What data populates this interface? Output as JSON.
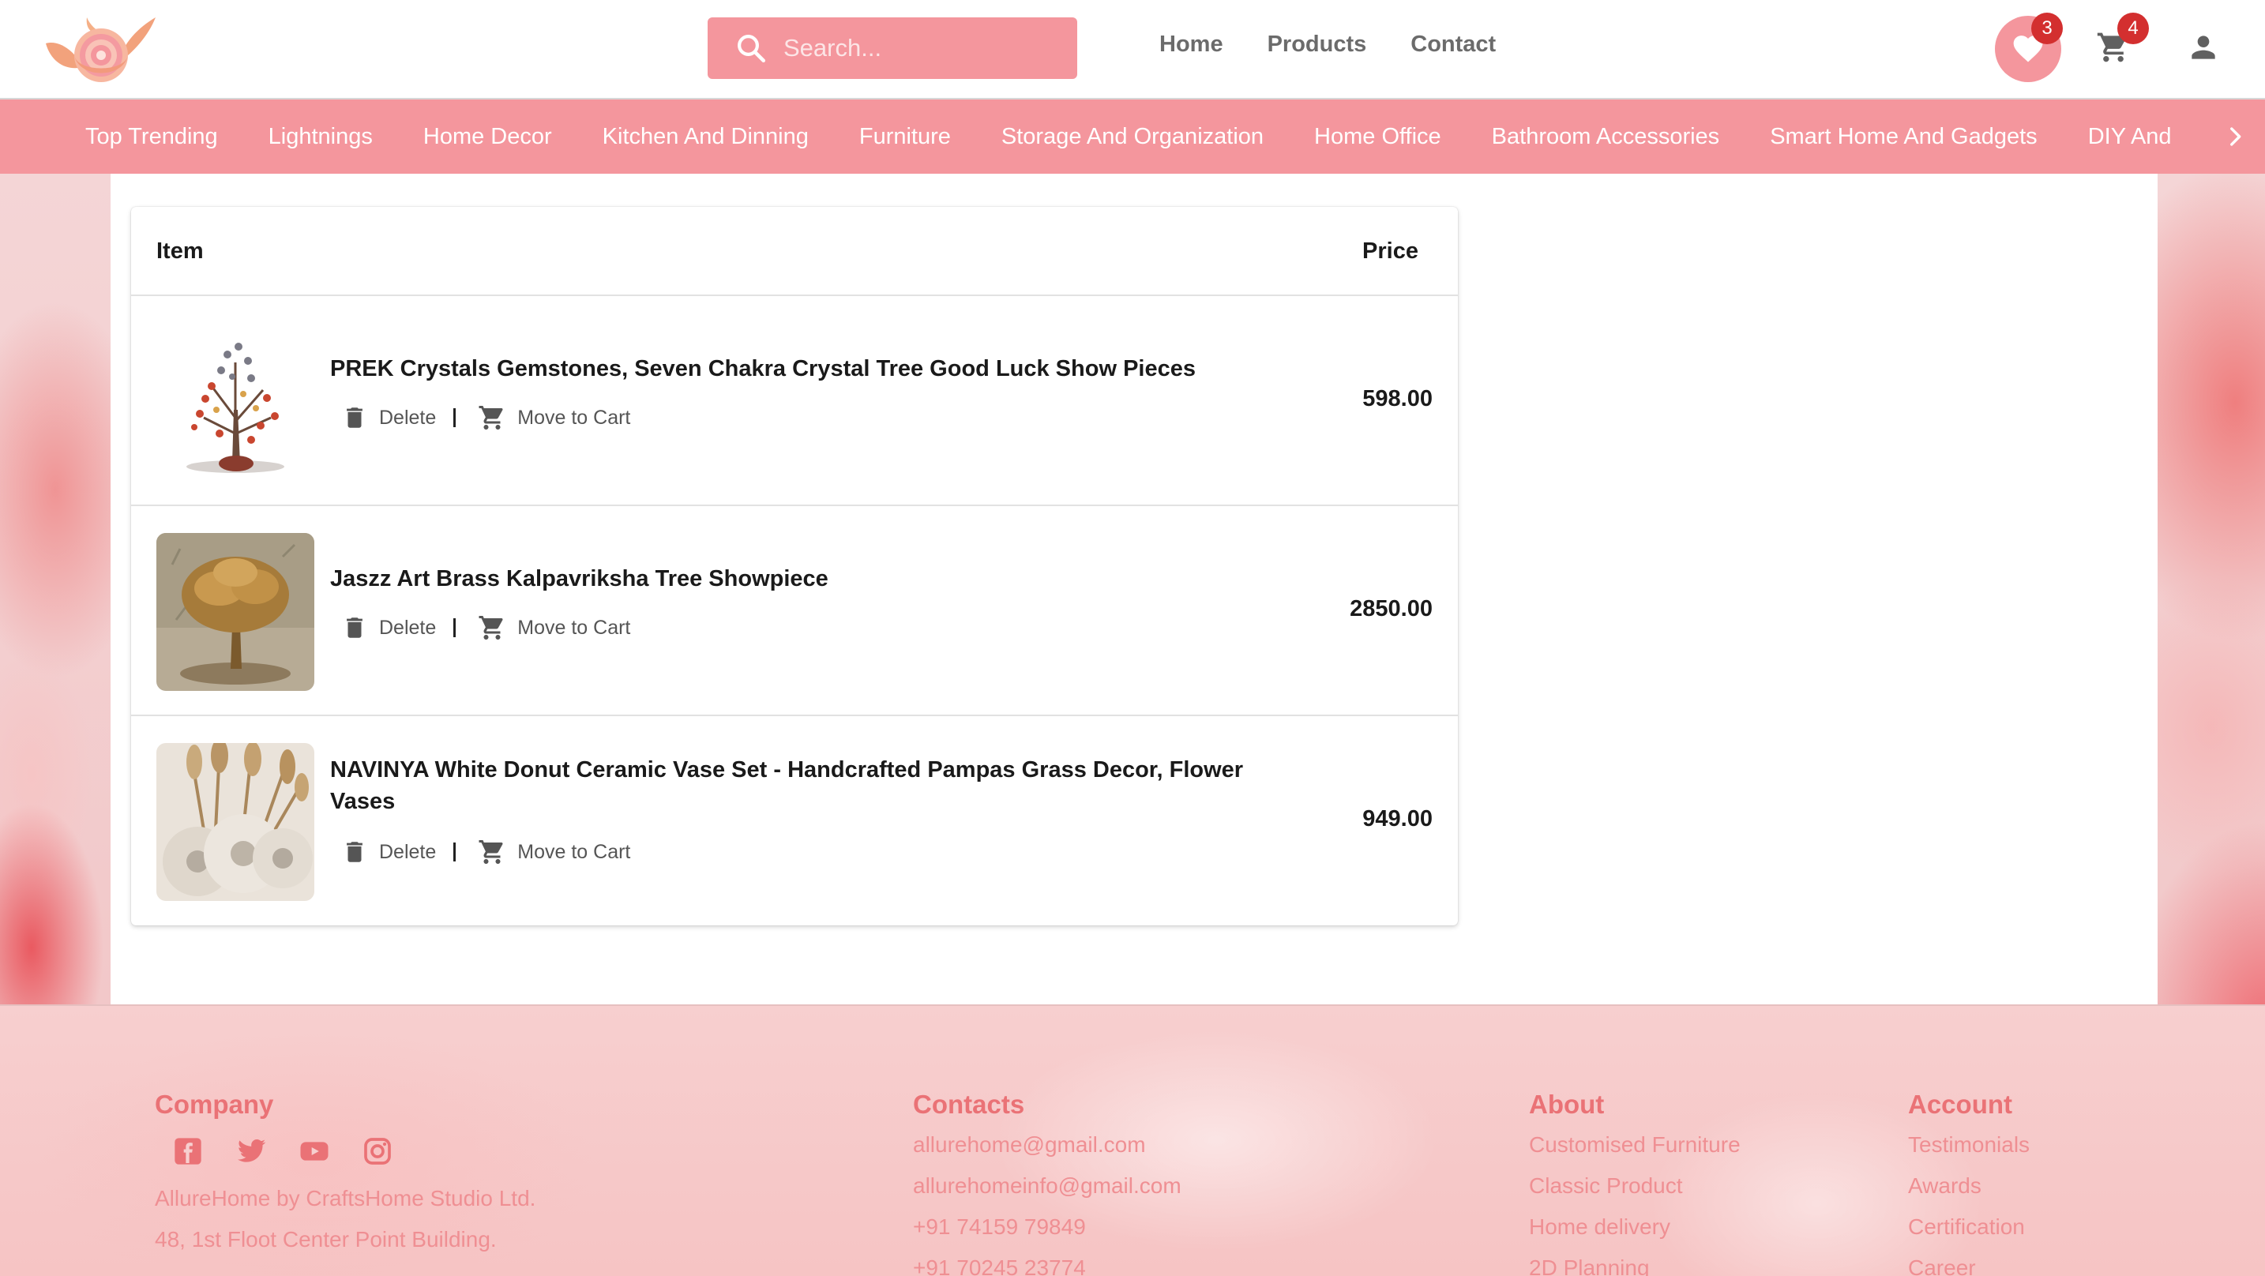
{
  "header": {
    "search_placeholder": "Search...",
    "nav": [
      "Home",
      "Products",
      "Contact"
    ],
    "wishlist_count": "3",
    "cart_count": "4"
  },
  "categories": [
    "Top Trending",
    "Lightnings",
    "Home Decor",
    "Kitchen And Dinning",
    "Furniture",
    "Storage And Organization",
    "Home Office",
    "Bathroom Accessories",
    "Smart Home And Gadgets",
    "DIY And"
  ],
  "wishlist": {
    "columns": {
      "item": "Item",
      "price": "Price"
    },
    "items": [
      {
        "name": "PREK Crystals Gemstones, Seven Chakra Crystal Tree Good Luck Show Pieces",
        "price": "598.00"
      },
      {
        "name": "Jaszz Art Brass Kalpavriksha Tree Showpiece",
        "price": "2850.00"
      },
      {
        "name": "NAVINYA White Donut Ceramic Vase Set - Handcrafted Pampas Grass Decor, Flower Vases",
        "price": "949.00"
      }
    ],
    "delete_label": "Delete",
    "move_label": "Move to Cart"
  },
  "footer": {
    "company": {
      "title": "Company",
      "lines": [
        "AllureHome by CraftsHome Studio Ltd.",
        "48, 1st Floot Center Point Building."
      ]
    },
    "contacts": {
      "title": "Contacts",
      "lines": [
        "allurehome@gmail.com",
        "allurehomeinfo@gmail.com",
        "+91 74159 79849",
        "+91 70245 23774"
      ]
    },
    "about": {
      "title": "About",
      "lines": [
        "Customised Furniture",
        "Classic Product",
        "Home delivery",
        "2D Planning"
      ]
    },
    "account": {
      "title": "Account",
      "lines": [
        "Testimonials",
        "Awards",
        "Certification",
        "Career"
      ]
    }
  },
  "colors": {
    "brand_pink": "#f4969d",
    "badge_red": "#d32f2f",
    "footer_heading": "#ea7276",
    "footer_link": "#ef8f93"
  },
  "icons": [
    "logo-flower-icon",
    "search-icon",
    "heart-icon",
    "cart-icon",
    "user-icon",
    "chevron-right-icon",
    "delete-icon",
    "cart-icon",
    "facebook-icon",
    "twitter-icon",
    "youtube-icon",
    "instagram-icon"
  ]
}
